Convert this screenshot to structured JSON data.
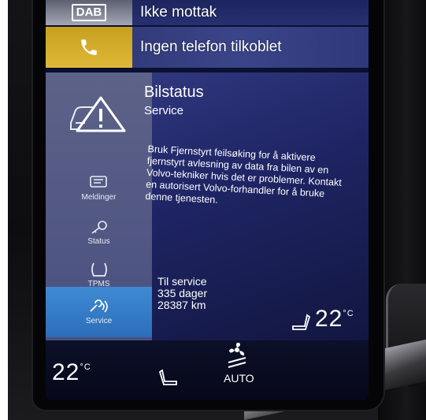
{
  "radio_row": {
    "badge": "DAB",
    "label": "Ikke mottak"
  },
  "phone_row": {
    "label": "Ingen telefon tilkoblet"
  },
  "car_status": {
    "title": "Bilstatus",
    "subtitle": "Service",
    "message": "Bruk Fjernstyrt feilsøking for å aktivere fjernstyrt avlesning av data fra bilen av en Volvo-tekniker hvis det er problemer. Kontakt en autorisert Volvo-forhandler for å bruke denne tjenesten.",
    "service_label": "Til service",
    "service_days": "335 dager",
    "service_km": "28387 km"
  },
  "sidebar": {
    "items": [
      {
        "label": "Meldinger",
        "icon": "message-icon"
      },
      {
        "label": "Status",
        "icon": "car-key-icon"
      },
      {
        "label": "TPMS",
        "icon": "tire-pressure-icon"
      },
      {
        "label": "Service",
        "icon": "service-wrench-icon",
        "active": true
      }
    ]
  },
  "climate": {
    "left_temp": "22",
    "right_temp": "22",
    "unit": "°C",
    "auto_label": "AUTO"
  },
  "colors": {
    "screen_background": "#1f2565",
    "sidebar_background": "#5d6288",
    "active_item": "#3f8ad4",
    "phone_accent": "#d8b030"
  }
}
